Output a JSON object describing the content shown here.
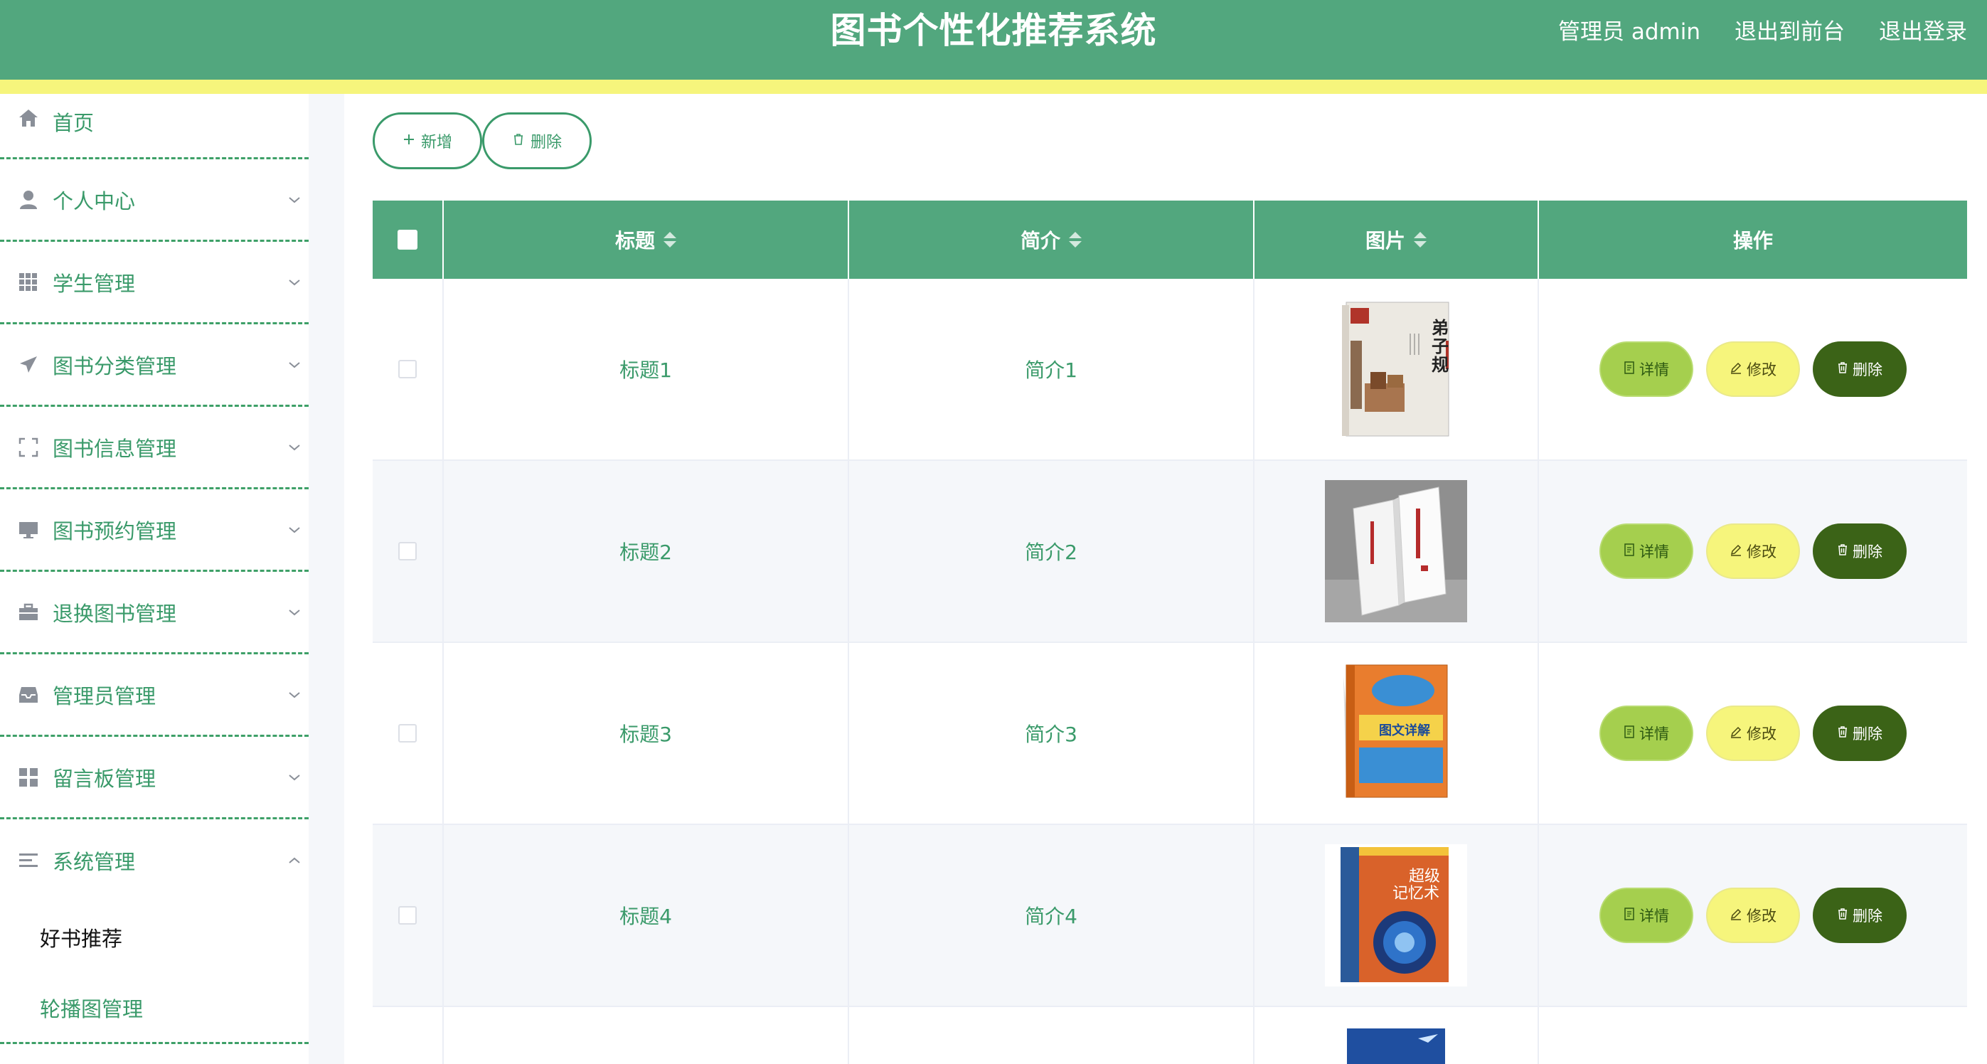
{
  "header": {
    "title": "图书个性化推荐系统",
    "admin_label": "管理员 admin",
    "front_link": "退出到前台",
    "logout_link": "退出登录"
  },
  "sidebar": {
    "items": [
      {
        "label": "首页",
        "icon": "home-icon"
      },
      {
        "label": "个人中心",
        "icon": "user-icon"
      },
      {
        "label": "学生管理",
        "icon": "grid-icon"
      },
      {
        "label": "图书分类管理",
        "icon": "paper-plane-icon"
      },
      {
        "label": "图书信息管理",
        "icon": "frame-icon"
      },
      {
        "label": "图书预约管理",
        "icon": "monitor-icon"
      },
      {
        "label": "退换图书管理",
        "icon": "briefcase-icon"
      },
      {
        "label": "管理员管理",
        "icon": "inbox-icon"
      },
      {
        "label": "留言板管理",
        "icon": "dashboard-icon"
      },
      {
        "label": "系统管理",
        "icon": "list-icon"
      }
    ],
    "submenu": [
      {
        "label": "好书推荐"
      },
      {
        "label": "轮播图管理"
      }
    ]
  },
  "toolbar": {
    "add_label": "新增",
    "delete_label": "删除"
  },
  "table": {
    "columns": [
      "标题",
      "简介",
      "图片",
      "操作"
    ],
    "rows": [
      {
        "title": "标题1",
        "intro": "简介1",
        "cover": "弟子规"
      },
      {
        "title": "标题2",
        "intro": "简介2",
        "cover": ""
      },
      {
        "title": "标题3",
        "intro": "简介3",
        "cover": "图文详解"
      },
      {
        "title": "标题4",
        "intro": "简介4",
        "cover": "超级记忆术"
      }
    ],
    "actions": {
      "detail": "详情",
      "edit": "修改",
      "delete": "删除"
    }
  },
  "colors": {
    "primary": "#52a77e",
    "accent_yellow": "#f6f57c",
    "detail_btn": "#a5cf4e",
    "delete_btn": "#3b6317"
  }
}
